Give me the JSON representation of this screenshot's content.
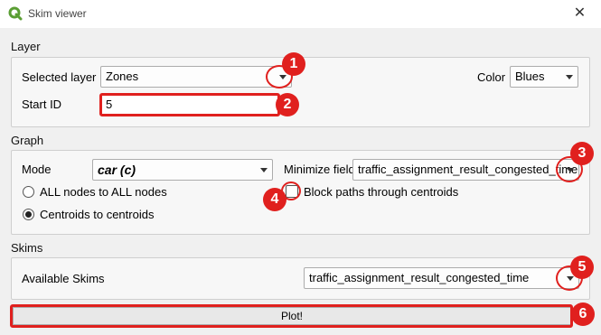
{
  "window": {
    "title": "Skim viewer",
    "close_glyph": "✕"
  },
  "layer": {
    "section_title": "Layer",
    "selected_layer_label": "Selected layer",
    "selected_layer_value": "Zones",
    "color_label": "Color",
    "color_value": "Blues",
    "start_id_label": "Start ID",
    "start_id_value": "5"
  },
  "graph": {
    "section_title": "Graph",
    "mode_label": "Mode",
    "mode_value": "car (c)",
    "minimize_field_label": "Minimize field",
    "minimize_field_value": "traffic_assignment_result_congested_time",
    "radio_all_nodes": "ALL nodes to ALL nodes",
    "radio_centroids": "Centroids to centroids",
    "block_paths_label": "Block paths through centroids"
  },
  "skims": {
    "section_title": "Skims",
    "available_label": "Available Skims",
    "available_value": "traffic_assignment_result_congested_time"
  },
  "plot_button_label": "Plot!",
  "annotations": [
    "1",
    "2",
    "3",
    "4",
    "5",
    "6"
  ],
  "colors": {
    "annotation": "#e0201e",
    "app_icon": "#5a9e33"
  },
  "icons": {
    "app": "qgis-icon",
    "close": "close-icon"
  }
}
